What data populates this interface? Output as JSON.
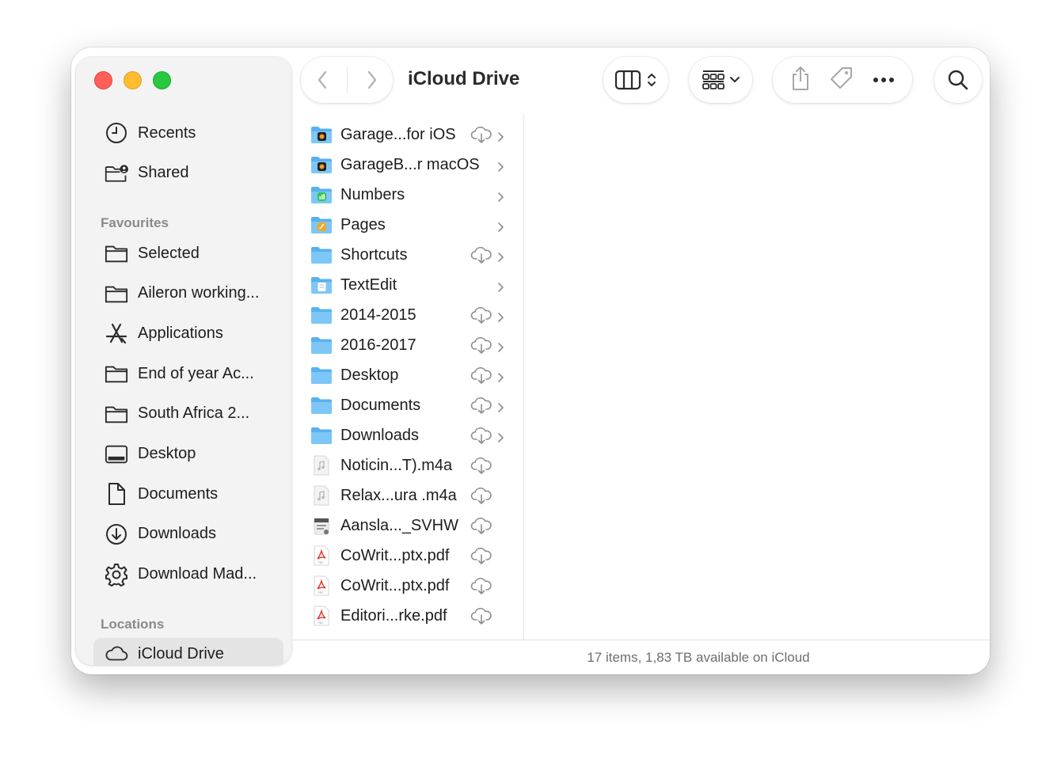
{
  "window": {
    "title": "iCloud Drive"
  },
  "sidebar": {
    "top_items": [
      {
        "label": "Recents",
        "icon": "clock-icon"
      },
      {
        "label": "Shared",
        "icon": "shared-folder-icon"
      }
    ],
    "favourites_title": "Favourites",
    "favourites": [
      {
        "label": "Selected",
        "icon": "folder-icon"
      },
      {
        "label": "Aileron working...",
        "icon": "folder-icon"
      },
      {
        "label": "Applications",
        "icon": "applications-icon"
      },
      {
        "label": "End of year Ac...",
        "icon": "folder-icon"
      },
      {
        "label": "South Africa 2...",
        "icon": "folder-icon"
      },
      {
        "label": "Desktop",
        "icon": "desktop-icon"
      },
      {
        "label": "Documents",
        "icon": "document-icon"
      },
      {
        "label": "Downloads",
        "icon": "download-icon"
      },
      {
        "label": "Download Mad...",
        "icon": "gear-icon"
      }
    ],
    "locations_title": "Locations",
    "locations": [
      {
        "label": "iCloud Drive",
        "icon": "icloud-icon",
        "selected": true
      }
    ]
  },
  "files": [
    {
      "name": "Garage...for iOS",
      "icon": "garageband-folder-icon",
      "cloud": true,
      "chevron": true
    },
    {
      "name": "GarageB...r macOS",
      "icon": "garageband-folder-icon",
      "cloud": false,
      "chevron": true
    },
    {
      "name": "Numbers",
      "icon": "numbers-folder-icon",
      "cloud": false,
      "chevron": true
    },
    {
      "name": "Pages",
      "icon": "pages-folder-icon",
      "cloud": false,
      "chevron": true
    },
    {
      "name": "Shortcuts",
      "icon": "folder-icon",
      "cloud": true,
      "chevron": true
    },
    {
      "name": "TextEdit",
      "icon": "textedit-folder-icon",
      "cloud": false,
      "chevron": true
    },
    {
      "name": "2014-2015",
      "icon": "folder-icon",
      "cloud": true,
      "chevron": true
    },
    {
      "name": "2016-2017",
      "icon": "folder-icon",
      "cloud": true,
      "chevron": true
    },
    {
      "name": "Desktop",
      "icon": "folder-icon",
      "cloud": true,
      "chevron": true
    },
    {
      "name": "Documents",
      "icon": "folder-icon",
      "cloud": true,
      "chevron": true
    },
    {
      "name": "Downloads",
      "icon": "folder-icon",
      "cloud": true,
      "chevron": true
    },
    {
      "name": "Noticin...T).m4a",
      "icon": "audio-file-icon",
      "cloud": true,
      "chevron": false
    },
    {
      "name": "Relax...ura .m4a",
      "icon": "audio-file-icon",
      "cloud": true,
      "chevron": false
    },
    {
      "name": "Aansla..._SVHW",
      "icon": "app-file-icon",
      "cloud": true,
      "chevron": false
    },
    {
      "name": "CoWrit...ptx.pdf",
      "icon": "pdf-file-icon",
      "cloud": true,
      "chevron": false
    },
    {
      "name": "CoWrit...ptx.pdf",
      "icon": "pdf-file-icon",
      "cloud": true,
      "chevron": false
    },
    {
      "name": "Editori...rke.pdf",
      "icon": "pdf-file-icon",
      "cloud": true,
      "chevron": false
    }
  ],
  "status": {
    "text": "17 items, 1,83 TB available on iCloud"
  },
  "colors": {
    "folder": "#5ab4ef",
    "selected_bg": "#e4e4e4",
    "sidebar_bg": "#f3f3f3"
  }
}
